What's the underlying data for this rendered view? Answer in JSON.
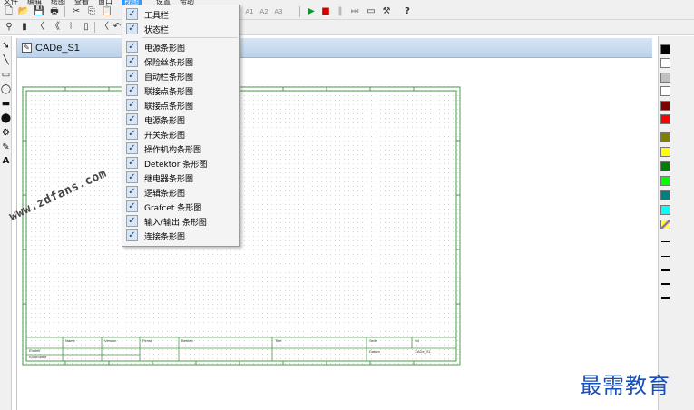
{
  "menubar": {
    "items": [
      {
        "label": "文件"
      },
      {
        "label": "编辑"
      },
      {
        "label": "绘图"
      },
      {
        "label": "查看"
      },
      {
        "label": "窗口"
      },
      {
        "label": "视图",
        "selected": true
      },
      {
        "label": "设置"
      },
      {
        "label": "帮助"
      }
    ]
  },
  "toolbar1": {
    "icons": [
      "new-file-icon",
      "open-folder-icon",
      "save-icon",
      "print-icon",
      "cut-icon",
      "copy-icon",
      "paste-icon",
      "undo-icon",
      "redo-icon",
      "zoom-icon",
      "run-icon",
      "stop-icon",
      "pause-icon",
      "step-icon",
      "window-icon",
      "tool-icon",
      "help-icon"
    ],
    "glyphs": {
      "new": "🗋",
      "open": "📂",
      "save": "💾",
      "print": "🖶",
      "cut": "✂",
      "copy": "⎘",
      "paste": "📋",
      "a1": "A1",
      "a2": "A2",
      "a3": "A3",
      "run": "▶",
      "stop": "■",
      "pause": "‖",
      "step": "⏭",
      "window": "▭",
      "tool": "⚒",
      "help": "?"
    }
  },
  "toolbar2": {
    "glyphs": [
      "⚲",
      "▮",
      "〈",
      "《",
      "⦚",
      "▯",
      "〈",
      "↶"
    ]
  },
  "tools": {
    "glyphs": [
      "➘",
      "╲",
      "▭",
      "◯",
      "▬",
      "⬤",
      "⚙",
      "✎",
      "A"
    ]
  },
  "palette": {
    "colors": [
      "#000000",
      "#ffffff",
      "#c0c0c0",
      "#ffffff",
      "#800000",
      "#ff0000",
      "#808000",
      "#ffff00",
      "#008000",
      "#00ff00",
      "#008080",
      "#00ffff",
      "#ffff40"
    ],
    "line_weights": [
      1,
      1,
      2,
      2,
      3
    ]
  },
  "document": {
    "title": "CADe_S1",
    "title_block": {
      "cells": [
        "Name",
        "Version",
        "Firma",
        "Betrieb",
        "Titel",
        "Seite",
        "Kd",
        "Datum",
        "CADe_S1",
        "Erstellt",
        "Kontrolliert"
      ]
    }
  },
  "view_menu": {
    "items": [
      {
        "label": "工具栏",
        "checked": true,
        "check_glyph": "✓"
      },
      {
        "label": "状态栏",
        "checked": true,
        "check_glyph": "✓"
      },
      {
        "label": "电源条形图",
        "checked": true,
        "check_glyph": "✓"
      },
      {
        "label": "保险丝条形图",
        "checked": true,
        "check_glyph": "✓"
      },
      {
        "label": "自动栏条形图",
        "checked": true,
        "check_glyph": "✓"
      },
      {
        "label": "联接点条形图",
        "checked": true,
        "check_glyph": "✓"
      },
      {
        "label": "联接点条形图",
        "checked": true,
        "check_glyph": "✓"
      },
      {
        "label": "电源条形图",
        "checked": true,
        "check_glyph": "✓"
      },
      {
        "label": "开关条形图",
        "checked": true,
        "check_glyph": "✓"
      },
      {
        "label": "操作机构条形图",
        "checked": true,
        "check_glyph": "✓"
      },
      {
        "label": "Detektor 条形图",
        "checked": true,
        "check_glyph": "✓"
      },
      {
        "label": "继电器条形图",
        "checked": true,
        "check_glyph": "✓"
      },
      {
        "label": "逻辑条形图",
        "checked": true,
        "check_glyph": "✓"
      },
      {
        "label": "Grafcet 条形图",
        "checked": true,
        "check_glyph": "✓"
      },
      {
        "label": "输入/输出 条形图",
        "checked": true,
        "check_glyph": "✓"
      },
      {
        "label": "连接条形图",
        "checked": true,
        "check_glyph": "✓"
      }
    ]
  },
  "watermarks": {
    "site": "www.zdfans.com",
    "brand": "最需教育",
    "brand_color": "#1a4fb6"
  }
}
